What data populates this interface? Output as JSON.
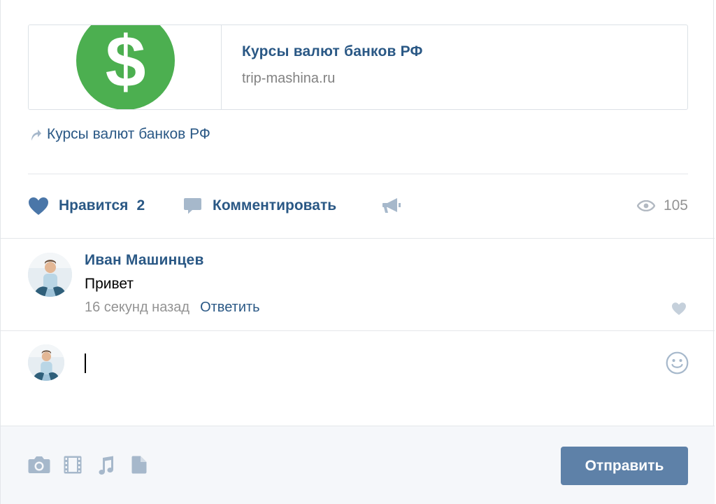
{
  "post": {
    "snippet": {
      "title": "Курсы валют банков РФ",
      "domain": "trip-mashina.ru",
      "thumb_icon": "dollar-icon",
      "thumb_color": "#4caf50",
      "thumb_symbol": "$"
    },
    "link_text": "Курсы валют банков РФ",
    "actions": {
      "like_label": "Нравится",
      "like_count": "2",
      "comment_label": "Комментировать",
      "views_count": "105"
    }
  },
  "comment": {
    "author": "Иван Машинцев",
    "text": "Привет",
    "time": "16 секунд назад",
    "reply_label": "Ответить"
  },
  "composer": {
    "value": "",
    "footer_icons": [
      "camera-icon",
      "video-icon",
      "music-icon",
      "document-icon"
    ],
    "send_label": "Отправить"
  },
  "colors": {
    "link": "#2a5885",
    "icon": "#a6b8cb",
    "muted": "#939393",
    "button": "#5e81a8",
    "like_heart": "#4a76a8"
  }
}
